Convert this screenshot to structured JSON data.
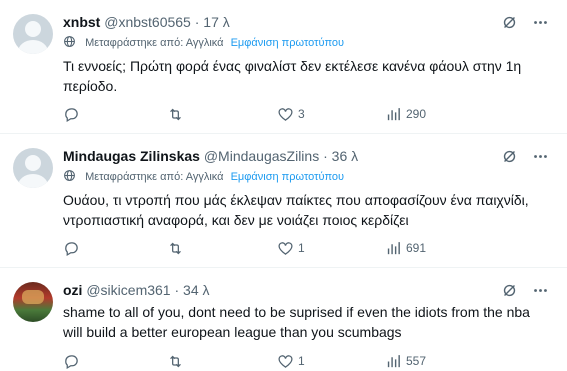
{
  "tweets": [
    {
      "name": "xnbst",
      "handle": "@xnbst60565",
      "time": "17 λ",
      "translated_label": "Μεταφράστηκε από: Αγγλικά",
      "show_original": "Εμφάνιση πρωτοτύπου",
      "text": "Τι εννοείς; Πρώτη φορά ένας φιναλίστ δεν εκτέλεσε κανένα φάουλ στην 1η περίοδο.",
      "replies": "",
      "retweets": "",
      "likes": "3",
      "views": "290"
    },
    {
      "name": "Mindaugas Zilinskas",
      "handle": "@MindaugasZilins",
      "time": "36 λ",
      "translated_label": "Μεταφράστηκε από: Αγγλικά",
      "show_original": "Εμφάνιση πρωτοτύπου",
      "text": "Ουάου, τι ντροπή που μάς έκλεψαν παίκτες που αποφασίζουν ένα παιχνίδι, ντροπιαστική αναφορά, και δεν με νοιάζει ποιος κερδίζει",
      "replies": "",
      "retweets": "",
      "likes": "1",
      "views": "691"
    },
    {
      "name": "ozi",
      "handle": "@sikicem361",
      "time": "34 λ",
      "text": "shame to all of you, dont need to be suprised if even the idiots from the nba will build a better european league than you scumbags",
      "replies": "",
      "retweets": "",
      "likes": "1",
      "views": "557"
    }
  ],
  "separator": "·",
  "icons": {
    "grok": "grok-slash-icon",
    "more": "more-dots-icon",
    "globe": "globe-icon",
    "reply": "reply-bubble-icon",
    "retweet": "retweet-arrows-icon",
    "like": "heart-icon",
    "views": "bar-chart-icon",
    "bookmark": "bookmark-icon",
    "share": "share-icon"
  },
  "colors": {
    "link": "#1d9bf0",
    "muted": "#536471",
    "text": "#0f1419"
  }
}
